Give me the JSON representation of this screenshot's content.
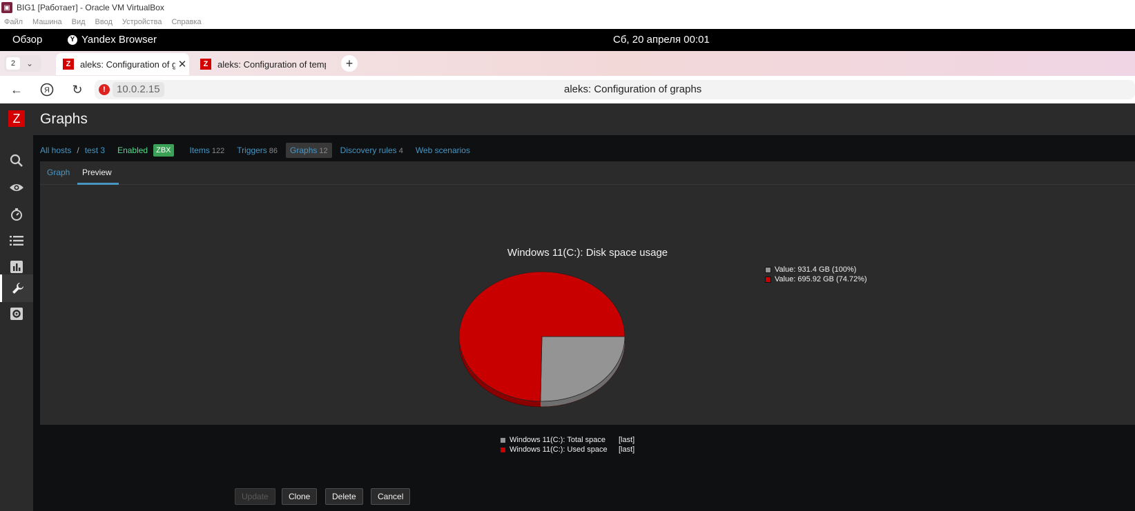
{
  "vbox": {
    "title": "BIG1 [Работает] - Oracle VM VirtualBox",
    "menu": [
      "Файл",
      "Машина",
      "Вид",
      "Ввод",
      "Устройства",
      "Справка"
    ]
  },
  "gnome": {
    "overview": "Обзор",
    "app_name": "Yandex Browser",
    "clock": "Сб, 20 апреля  00:01"
  },
  "browser": {
    "tab_count": "2",
    "tabs": [
      {
        "title": "aleks: Configuration of graphs"
      },
      {
        "title": "aleks: Configuration of templates"
      }
    ],
    "address_host": "10.0.2.15",
    "address_title": "aleks: Configuration of graphs"
  },
  "zabbix": {
    "logo": "Z",
    "page_title": "Graphs",
    "sidebar_icons": [
      "search-icon",
      "eye-icon",
      "stopwatch-icon",
      "list-icon",
      "chart-icon",
      "wrench-icon",
      "gear-icon"
    ],
    "breadcrumbs": {
      "all_hosts": "All hosts",
      "sep": "/",
      "host": "test 3",
      "status": "Enabled",
      "badge": "ZBX",
      "items": {
        "label": "Items",
        "count": "122"
      },
      "triggers": {
        "label": "Triggers",
        "count": "86"
      },
      "graphs": {
        "label": "Graphs",
        "count": "12"
      },
      "discovery": {
        "label": "Discovery rules",
        "count": "4"
      },
      "web": {
        "label": "Web scenarios"
      }
    },
    "tabs": {
      "graph": "Graph",
      "preview": "Preview"
    },
    "buttons": {
      "update": "Update",
      "clone": "Clone",
      "delete": "Delete",
      "cancel": "Cancel"
    }
  },
  "chart_data": {
    "type": "pie",
    "title": "Windows 11(C:): Disk space usage",
    "series": [
      {
        "name": "Windows 11(C:): Total space",
        "func": "[last]",
        "legend_value": "Value: 931.4 GB (100%)",
        "value": 931.4,
        "color": "#949494"
      },
      {
        "name": "Windows 11(C:): Used space",
        "func": "[last]",
        "legend_value": "Value: 695.92 GB (74.72%)",
        "value": 695.92,
        "color": "#c80000"
      }
    ],
    "slices_percent": [
      25.28,
      74.72
    ]
  }
}
